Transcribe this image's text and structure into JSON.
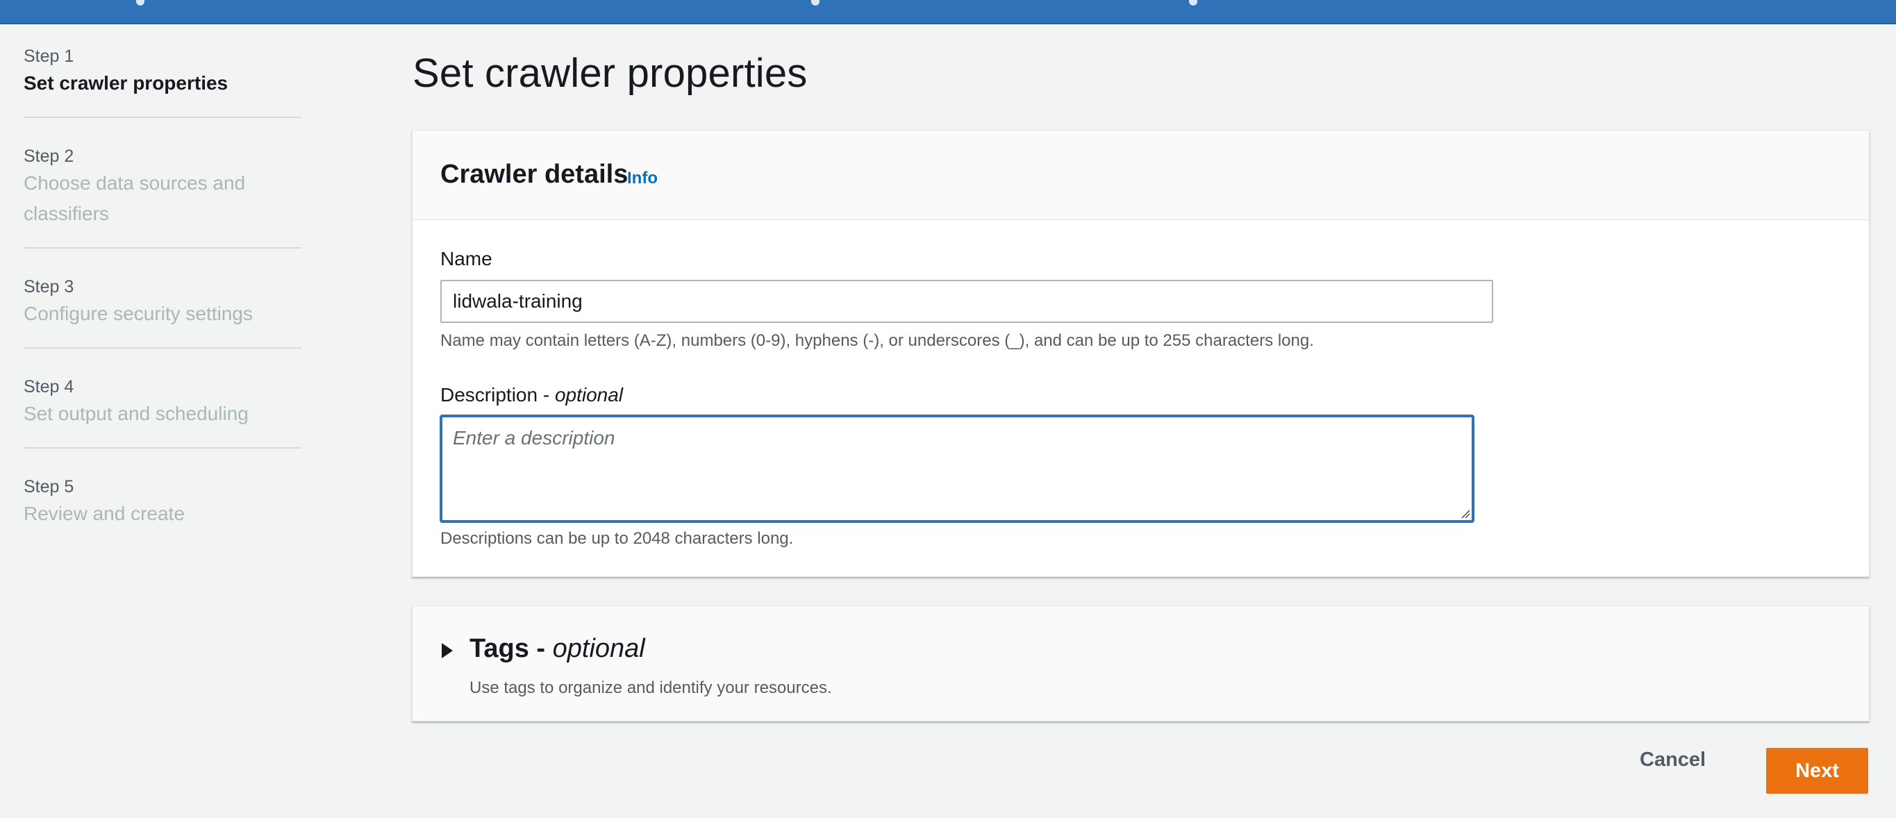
{
  "steps": [
    {
      "label": "Step 1",
      "title": "Set crawler properties"
    },
    {
      "label": "Step 2",
      "title": "Choose data sources and classifiers"
    },
    {
      "label": "Step 3",
      "title": "Configure security settings"
    },
    {
      "label": "Step 4",
      "title": "Set output and scheduling"
    },
    {
      "label": "Step 5",
      "title": "Review and create"
    }
  ],
  "page_title": "Set crawler properties",
  "crawler_details": {
    "heading": "Crawler details",
    "info_link": "Info",
    "name_label": "Name",
    "name_value": "lidwala-training",
    "name_hint": "Name may contain letters (A-Z), numbers (0-9), hyphens (-), or underscores (_), and can be up to 255 characters long.",
    "description_label": "Description - ",
    "description_optional": "optional",
    "description_placeholder": "Enter a description",
    "description_hint": "Descriptions can be up to 2048 characters long."
  },
  "tags": {
    "title": "Tags - ",
    "optional": "optional",
    "subtitle": "Use tags to organize and identify your resources."
  },
  "actions": {
    "cancel": "Cancel",
    "next": "Next"
  },
  "colors": {
    "topbar": "#2f72b8",
    "primary_button": "#ec7211",
    "link": "#0073bb",
    "focus_border": "#2f72b8"
  }
}
